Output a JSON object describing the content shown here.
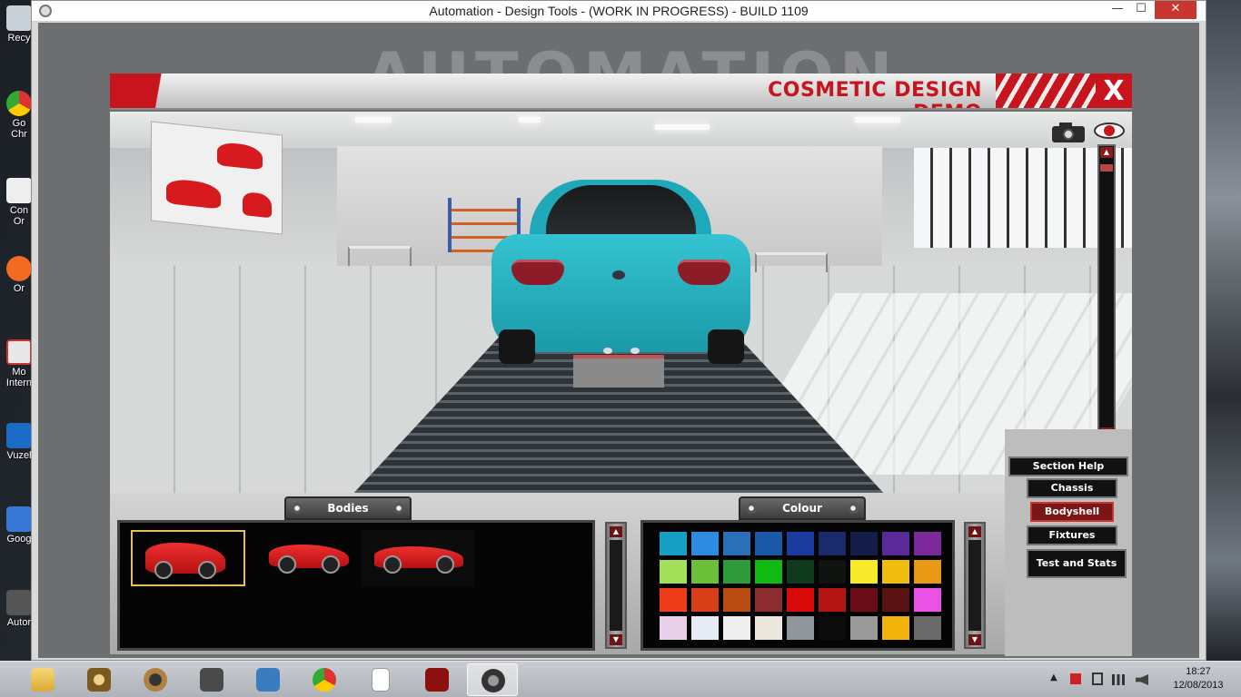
{
  "window": {
    "title": "Automation - Design Tools - (WORK IN PROGRESS) - BUILD 1109",
    "minimize": "—",
    "maximize": "☐",
    "close": "✕"
  },
  "desktop_icons": [
    {
      "label": "Recy",
      "icon": "recycle-bin-icon"
    },
    {
      "label": "Go Chr",
      "icon": "chrome-shortcut-icon"
    },
    {
      "label": "Con Or",
      "icon": "shortcut-icon"
    },
    {
      "label": "Or",
      "icon": "origin-shortcut-icon"
    },
    {
      "label": "Mo Intern",
      "icon": "firefox-shortcut-icon"
    },
    {
      "label": "Vuzel",
      "icon": "shortcut-icon"
    },
    {
      "label": "Goog",
      "icon": "google-shortcut-icon"
    },
    {
      "label": "Autor",
      "icon": "automation-shortcut-icon"
    }
  ],
  "panel": {
    "title": "COSMETIC DESIGN DEMO",
    "close_label": "X"
  },
  "viewport": {
    "camera_icon": "camera-icon",
    "eye_icon": "eye-icon",
    "zoom_up": "▲",
    "zoom_down": "▼",
    "reset_label": "✕"
  },
  "bodies": {
    "title": "Bodies",
    "items": [
      {
        "name": "hatchback-body",
        "selected": true
      },
      {
        "name": "coupe-body",
        "selected": false
      },
      {
        "name": "sports-body",
        "selected": false
      }
    ],
    "scroll_up": "▲",
    "scroll_down": "▼"
  },
  "colour": {
    "title": "Colour",
    "scroll_up": "▲",
    "scroll_down": "▼",
    "swatches": [
      "#169fc3",
      "#2e8be0",
      "#2a6fb8",
      "#1a58a8",
      "#1c3b9e",
      "#1b2a6a",
      "#141c48",
      "#5a2a9a",
      "#7a2a9a",
      "#a3e05a",
      "#6cbf38",
      "#2f9a3c",
      "#0fbb12",
      "#0f3a1e",
      "#0f1410",
      "#f6ea2a",
      "#f1bc10",
      "#e89a14",
      "#ef3d1a",
      "#d83e18",
      "#b84a12",
      "#8a2c30",
      "#d80a0a",
      "#b41414",
      "#6a0c18",
      "#5a1212",
      "#ea52e6",
      "#e8d0e8",
      "#e6ebf5",
      "#eeeeee",
      "#ebe7dc",
      "#8e969c",
      "#0c0c0c",
      "#9a9a9a",
      "#f2b40a",
      "#6a6a6a"
    ]
  },
  "nav": {
    "section_help": "Section Help",
    "chassis": "Chassis",
    "bodyshell": "Bodyshell",
    "fixtures": "Fixtures",
    "test_and_stats": "Test and Stats",
    "active": "bodyshell"
  },
  "taskbar": {
    "apps": [
      "file-explorer-icon",
      "steam-icon",
      "speaker-app-icon",
      "doc-app-icon",
      "control-panel-icon",
      "chrome-icon",
      "blank-document-icon",
      "power-app-icon",
      "automation-app-icon"
    ],
    "active_index": 8,
    "tray": {
      "show_hidden": "▲"
    },
    "time": "18:27",
    "date": "12/08/2013"
  },
  "colors": {
    "accent_red": "#c8141c",
    "car_teal": "#23b2c1"
  }
}
